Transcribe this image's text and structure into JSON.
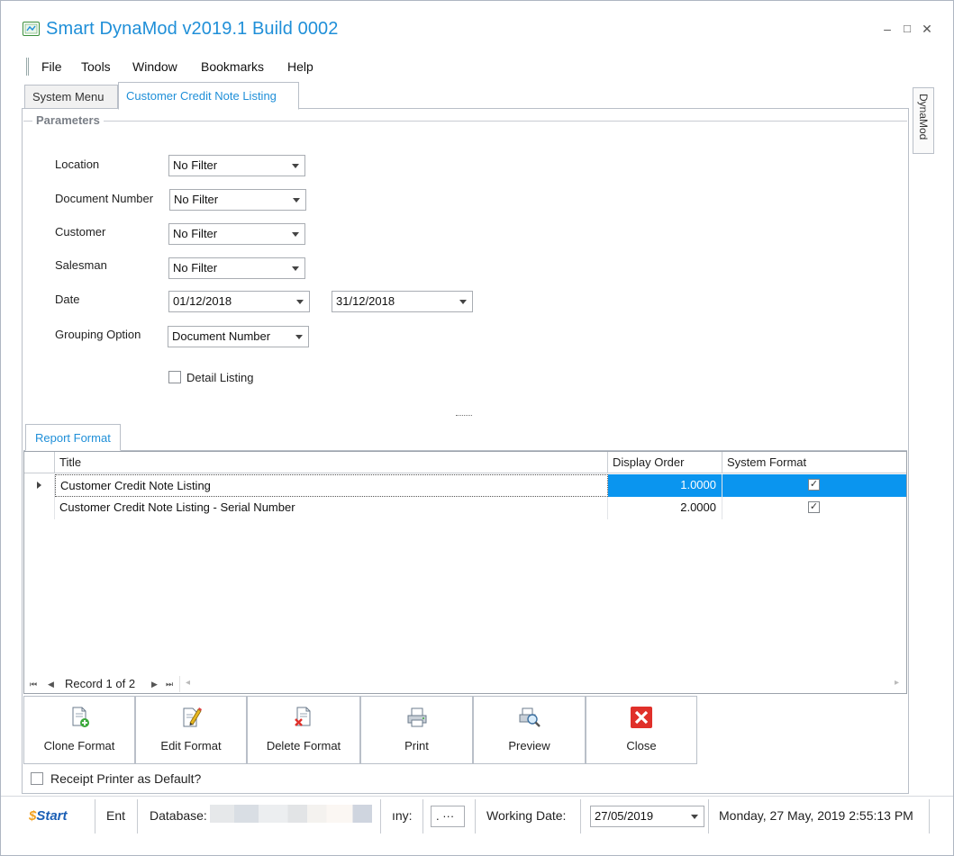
{
  "window": {
    "title": "Smart DynaMod v2019.1 Build 0002",
    "minimize": "–",
    "maximize": "□",
    "close": "✕"
  },
  "menu": [
    "File",
    "Tools",
    "Window",
    "Bookmarks",
    "Help"
  ],
  "tabs": [
    {
      "label": "System Menu",
      "active": false
    },
    {
      "label": "Customer Credit Note Listing",
      "active": true
    }
  ],
  "side_tab": "DynaMod",
  "parameters": {
    "caption": "Parameters",
    "location": {
      "label": "Location",
      "value": "No Filter"
    },
    "document_number": {
      "label": "Document Number",
      "value": "No Filter"
    },
    "customer": {
      "label": "Customer",
      "value": "No Filter"
    },
    "salesman": {
      "label": "Salesman",
      "value": "No Filter"
    },
    "date": {
      "label": "Date",
      "from": "01/12/2018",
      "to": "31/12/2018"
    },
    "grouping": {
      "label": "Grouping Option",
      "value": "Document Number"
    },
    "detail_listing": {
      "label": "Detail Listing",
      "checked": false
    }
  },
  "report_format": {
    "tab_label": "Report Format",
    "columns": [
      "Title",
      "Display Order",
      "System Format"
    ],
    "rows": [
      {
        "title": "Customer Credit Note Listing",
        "display_order": "1.0000",
        "system_format": "✓",
        "selected": true
      },
      {
        "title": "Customer Credit Note Listing - Serial Number",
        "display_order": "2.0000",
        "system_format": "✓",
        "selected": false
      }
    ],
    "navigator": {
      "first": "⏮",
      "prev": "◀",
      "record_text": "Record 1 of 2",
      "next": "▶",
      "last": "⏭",
      "scroll_left": "◂",
      "scroll_right": "▸"
    }
  },
  "buttons": {
    "clone": "Clone Format",
    "edit": "Edit Format",
    "delete": "Delete Format",
    "print": "Print",
    "preview": "Preview",
    "close": "Close"
  },
  "receipt_printer": {
    "label": "Receipt Printer as Default?",
    "checked": false
  },
  "statusbar": {
    "start": "Start",
    "ent": "Ent",
    "database_label": "Database: ",
    "company_label": "ıny:",
    "company_btn": ". ···",
    "working_date_label": "Working Date:",
    "working_date": "27/05/2019",
    "datetime": "Monday, 27 May, 2019 2:55:13 PM"
  },
  "colors": {
    "accent": "#1f8fd8",
    "selection": "#0a95ef",
    "close_icon": "#e0302a"
  }
}
